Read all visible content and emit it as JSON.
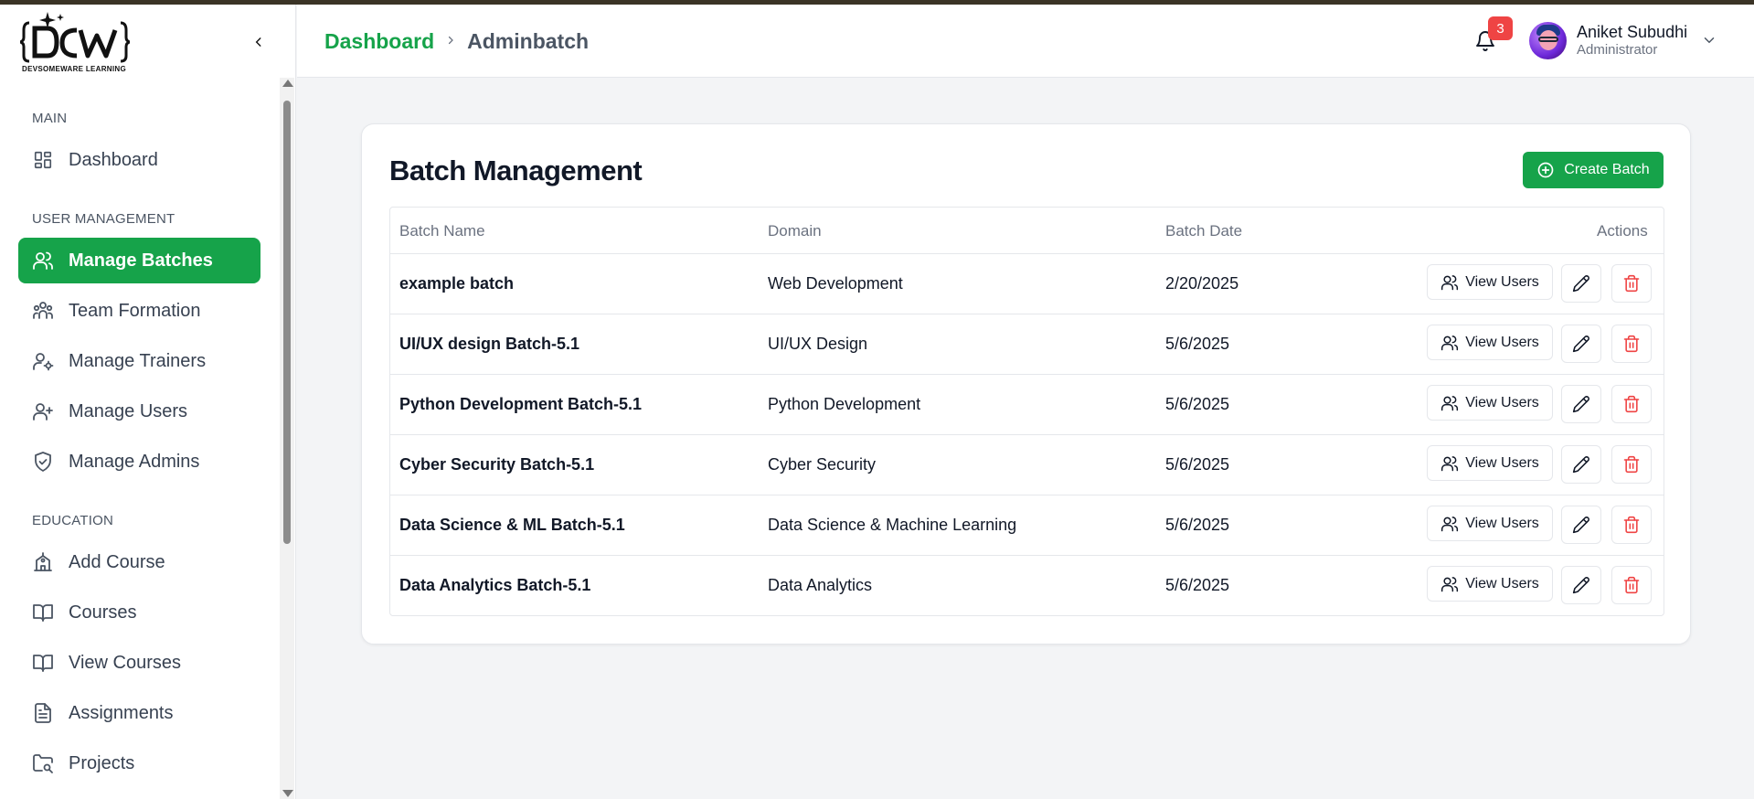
{
  "brand": {
    "logo_text": "DEVSOMEWARE LEARNING",
    "accent": "#16a34a",
    "danger": "#ef4444"
  },
  "sidebar": {
    "sections": [
      {
        "label": "MAIN",
        "items": [
          {
            "label": "Dashboard",
            "icon": "dashboard-grid-icon"
          }
        ]
      },
      {
        "label": "USER MANAGEMENT",
        "items": [
          {
            "label": "Manage Batches",
            "icon": "users-icon",
            "active": true
          },
          {
            "label": "Team Formation",
            "icon": "team-icon"
          },
          {
            "label": "Manage Trainers",
            "icon": "user-cog-icon"
          },
          {
            "label": "Manage Users",
            "icon": "user-plus-icon"
          },
          {
            "label": "Manage Admins",
            "icon": "shield-check-icon"
          }
        ]
      },
      {
        "label": "EDUCATION",
        "items": [
          {
            "label": "Add Course",
            "icon": "school-icon"
          },
          {
            "label": "Courses",
            "icon": "book-open-icon"
          },
          {
            "label": "View Courses",
            "icon": "book-open-icon"
          },
          {
            "label": "Assignments",
            "icon": "file-text-icon"
          },
          {
            "label": "Projects",
            "icon": "folder-search-icon"
          }
        ]
      }
    ]
  },
  "header": {
    "breadcrumb": {
      "root": "Dashboard",
      "current": "Adminbatch"
    },
    "notifications_count": "3",
    "user": {
      "name": "Aniket Subudhi",
      "role": "Administrator"
    }
  },
  "main": {
    "title": "Batch Management",
    "create_label": "Create Batch",
    "table": {
      "headers": {
        "name": "Batch Name",
        "domain": "Domain",
        "date": "Batch Date",
        "actions": "Actions"
      },
      "view_label": "View Users",
      "rows": [
        {
          "name": "example batch",
          "domain": "Web Development",
          "date": "2/20/2025"
        },
        {
          "name": "UI/UX design Batch-5.1",
          "domain": "UI/UX Design",
          "date": "5/6/2025"
        },
        {
          "name": "Python Development Batch-5.1",
          "domain": "Python Development",
          "date": "5/6/2025"
        },
        {
          "name": "Cyber Security Batch-5.1",
          "domain": "Cyber Security",
          "date": "5/6/2025"
        },
        {
          "name": "Data Science & ML Batch-5.1",
          "domain": "Data Science & Machine Learning",
          "date": "5/6/2025"
        },
        {
          "name": "Data Analytics Batch-5.1",
          "domain": "Data Analytics",
          "date": "5/6/2025"
        }
      ]
    }
  }
}
